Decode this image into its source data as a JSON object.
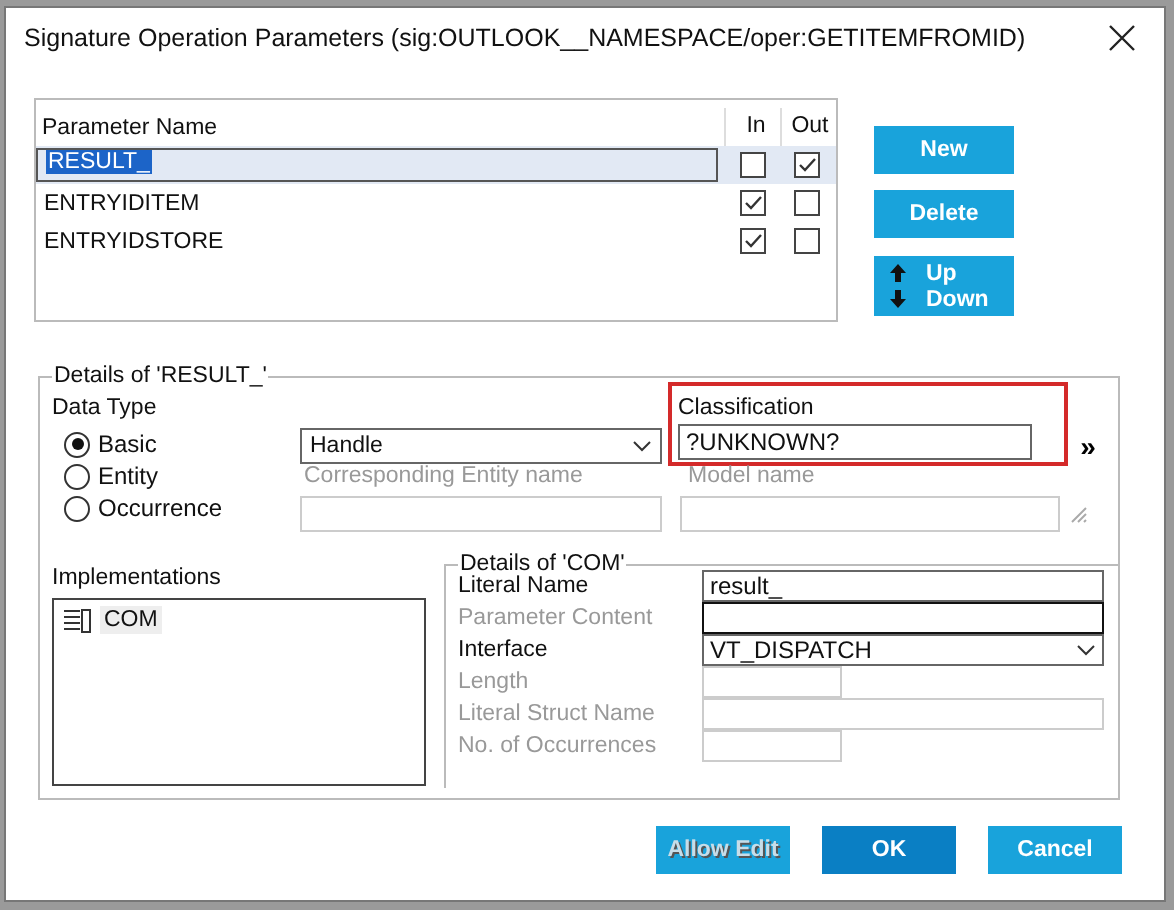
{
  "window": {
    "title": "Signature Operation Parameters (sig:OUTLOOK__NAMESPACE/oper:GETITEMFROMID)"
  },
  "parameters": {
    "columns": [
      "Parameter Name",
      "In",
      "Out"
    ],
    "rows": [
      {
        "name": "RESULT_",
        "in": false,
        "out": true,
        "selected": true
      },
      {
        "name": "ENTRYIDITEM",
        "in": true,
        "out": false,
        "selected": false
      },
      {
        "name": "ENTRYIDSTORE",
        "in": true,
        "out": false,
        "selected": false
      }
    ]
  },
  "side_buttons": [
    {
      "label": "New",
      "kind": "plain"
    },
    {
      "label": "Delete",
      "kind": "plain"
    },
    {
      "label": "Up",
      "kind": "up"
    },
    {
      "label": "Down",
      "kind": "down"
    }
  ],
  "details": {
    "title": "Details of 'RESULT_'",
    "data_type_label": "Data Type",
    "options": [
      {
        "label": "Basic",
        "selected": true
      },
      {
        "label": "Entity",
        "selected": false
      },
      {
        "label": "Occurrence",
        "selected": false
      }
    ],
    "basic_type": "Handle",
    "classification": {
      "label": "Classification",
      "value": "?UNKNOWN?",
      "highlighted": true,
      "more": "»"
    },
    "entity_label": "Corresponding Entity name",
    "model_label": "Model name"
  },
  "implementations": {
    "label": "Implementations",
    "items": [
      {
        "label": "COM",
        "selected": true
      }
    ]
  },
  "com": {
    "title": "Details of 'COM'",
    "fields": [
      {
        "label": "Literal Name",
        "kind": "text",
        "value": "result_",
        "disabled": false,
        "focused": false
      },
      {
        "label": "Parameter Content",
        "kind": "text",
        "disabled": true,
        "focused": true
      },
      {
        "label": "Interface",
        "kind": "dropdown",
        "value": "VT_DISPATCH",
        "disabled": false,
        "focused": false
      },
      {
        "label": "Length",
        "kind": "short",
        "disabled": true,
        "focused": false
      },
      {
        "label": "Literal Struct Name",
        "kind": "text",
        "disabled": true,
        "focused": false
      },
      {
        "label": "No. of Occurrences",
        "kind": "short",
        "disabled": true,
        "focused": false
      }
    ]
  },
  "buttons": [
    {
      "label": "Allow Edit",
      "kind": "disabled"
    },
    {
      "label": "OK",
      "kind": "primary"
    },
    {
      "label": "Cancel",
      "kind": "default"
    }
  ]
}
